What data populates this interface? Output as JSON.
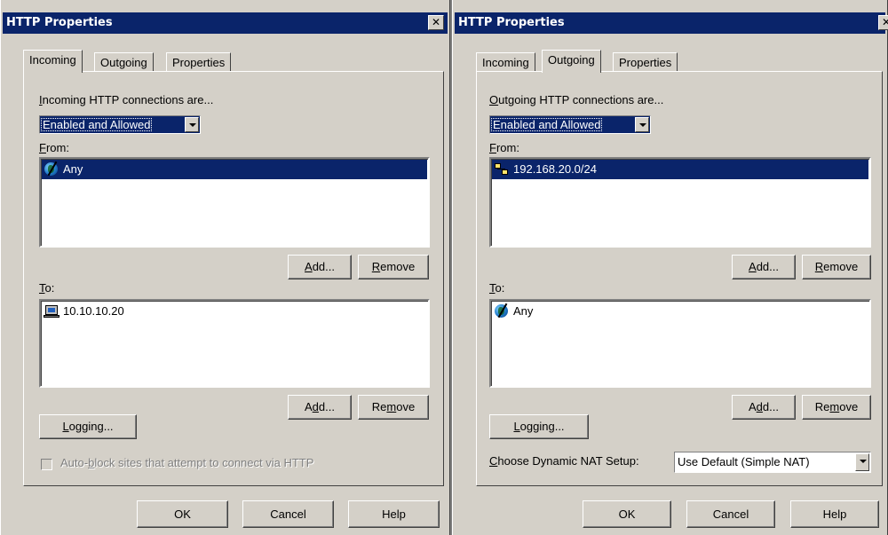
{
  "dialogs": [
    {
      "title": "HTTP Properties",
      "tabs": [
        {
          "label": "Incoming",
          "active": true
        },
        {
          "label": "Outgoing",
          "active": false
        },
        {
          "label": "Properties",
          "active": false
        }
      ],
      "connections": {
        "label_u": "I",
        "label_rest": "ncoming HTTP connections are...",
        "value": "Enabled and Allowed"
      },
      "from": {
        "label_u": "F",
        "label_rest": "rom:",
        "items": [
          {
            "icon": "globe-icon",
            "text": "Any",
            "selected": true
          }
        ],
        "add_u": "A",
        "add_rest": "dd...",
        "remove_u": "R",
        "remove_rest": "emove"
      },
      "to": {
        "label_u": "T",
        "label_rest": "o:",
        "items": [
          {
            "icon": "computer-icon",
            "text": "10.10.10.20",
            "selected": false
          }
        ],
        "add_pre": "A",
        "add_u": "d",
        "add_rest": "d...",
        "remove_pre": "Re",
        "remove_u": "m",
        "remove_rest": "ove"
      },
      "logging": {
        "u": "L",
        "rest": "ogging..."
      },
      "autoblock": {
        "pre": "Auto-",
        "u": "b",
        "rest": "lock sites that attempt to connect via HTTP",
        "checked": false,
        "disabled": true
      },
      "buttons": {
        "ok": "OK",
        "cancel": "Cancel",
        "help": "Help"
      }
    },
    {
      "title": "HTTP Properties",
      "tabs": [
        {
          "label": "Incoming",
          "active": false
        },
        {
          "label": "Outgoing",
          "active": true
        },
        {
          "label": "Properties",
          "active": false
        }
      ],
      "connections": {
        "label_u": "O",
        "label_rest": "utgoing HTTP connections are...",
        "value": "Enabled and Allowed"
      },
      "from": {
        "label_u": "F",
        "label_rest": "rom:",
        "items": [
          {
            "icon": "network-icon",
            "text": "192.168.20.0/24",
            "selected": true
          }
        ],
        "add_u": "A",
        "add_rest": "dd...",
        "remove_u": "R",
        "remove_rest": "emove"
      },
      "to": {
        "label_u": "T",
        "label_rest": "o:",
        "items": [
          {
            "icon": "globe-icon",
            "text": "Any",
            "selected": false
          }
        ],
        "add_pre": "A",
        "add_u": "d",
        "add_rest": "d...",
        "remove_pre": "Re",
        "remove_u": "m",
        "remove_rest": "ove"
      },
      "logging": {
        "u": "L",
        "rest": "ogging..."
      },
      "nat": {
        "label_u": "C",
        "label_rest": "hoose Dynamic NAT Setup:",
        "value": "Use Default (Simple NAT)"
      },
      "buttons": {
        "ok": "OK",
        "cancel": "Cancel",
        "help": "Help"
      }
    }
  ],
  "colors": {
    "face": "#d4d0c8",
    "titlebar": "#0a246a",
    "selection": "#0a246a"
  }
}
